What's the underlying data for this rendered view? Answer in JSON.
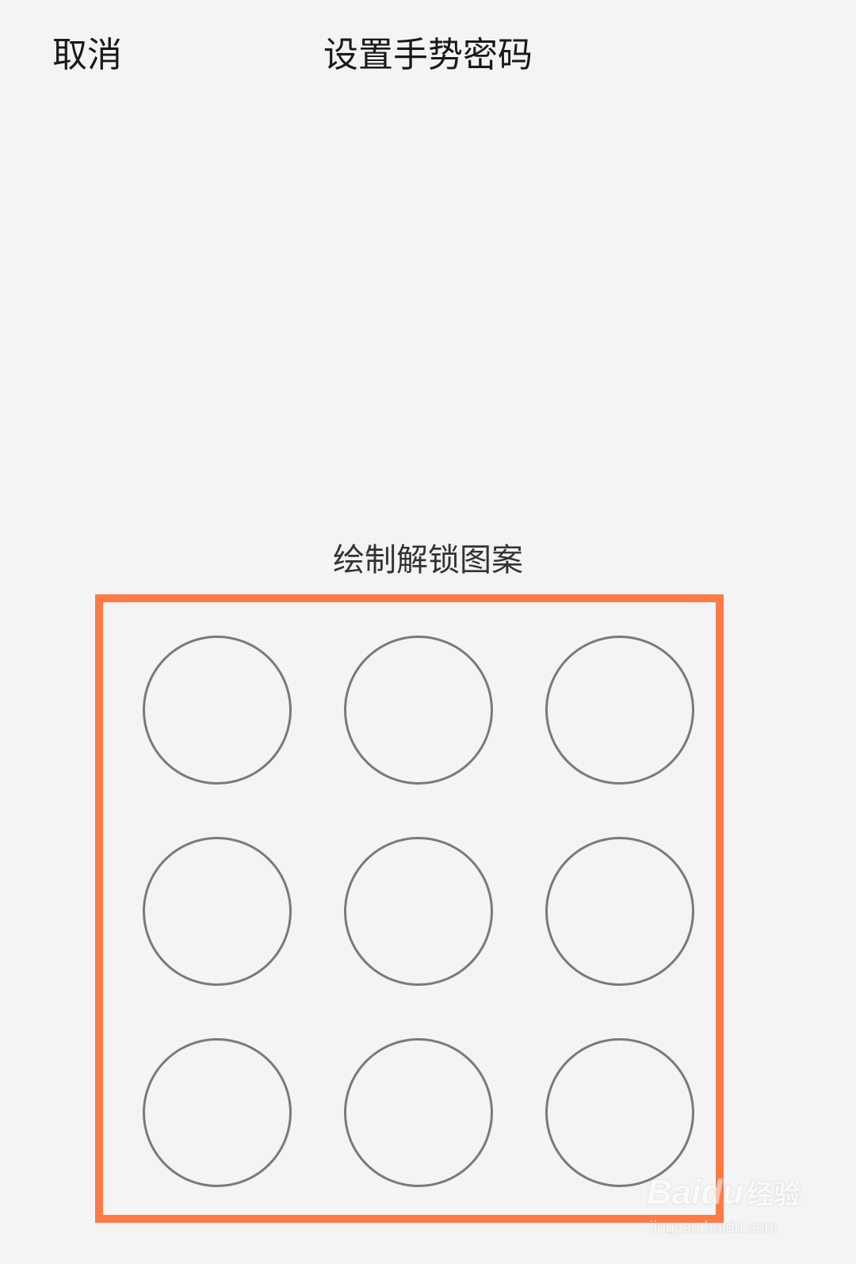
{
  "nav": {
    "cancel_label": "取消",
    "title": "设置手势密码"
  },
  "hint": "绘制解锁图案",
  "pattern": {
    "rows": 3,
    "cols": 3,
    "dot_border_color": "#7a7a7a"
  },
  "annotation": {
    "box_color": "#ff7a45"
  },
  "watermark": {
    "brand": "Baidu",
    "product": "经验",
    "url": "jingyan.baidu.com"
  }
}
